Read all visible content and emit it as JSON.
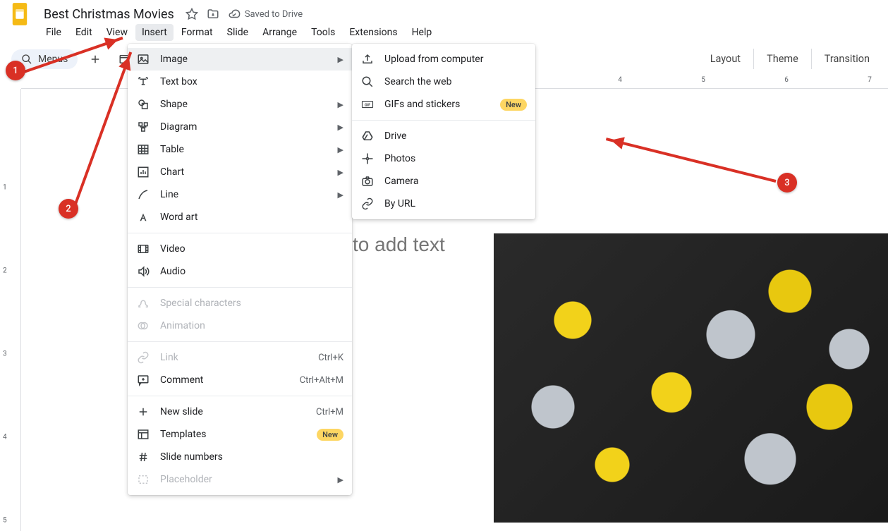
{
  "doc": {
    "title": "Best Christmas Movies",
    "save_status": "Saved to Drive"
  },
  "menus": {
    "file": "File",
    "edit": "Edit",
    "view": "View",
    "insert": "Insert",
    "format": "Format",
    "slide": "Slide",
    "arrange": "Arrange",
    "tools": "Tools",
    "extensions": "Extensions",
    "help": "Help"
  },
  "toolbar": {
    "search_label": "Menus",
    "layout": "Layout",
    "theme": "Theme",
    "transition": "Transition"
  },
  "ruler": {
    "h": {
      "4": "4",
      "5": "5",
      "6": "6",
      "7": "7"
    },
    "v": {
      "1": "1",
      "2": "2",
      "3": "3",
      "4": "4",
      "5": "5"
    }
  },
  "canvas": {
    "placeholder": "to add text"
  },
  "insert_menu": {
    "image": "Image",
    "text_box": "Text box",
    "shape": "Shape",
    "diagram": "Diagram",
    "table": "Table",
    "chart": "Chart",
    "line": "Line",
    "word_art": "Word art",
    "video": "Video",
    "audio": "Audio",
    "special_chars": "Special characters",
    "animation": "Animation",
    "link": "Link",
    "link_k": "Ctrl+K",
    "comment": "Comment",
    "comment_k": "Ctrl+Alt+M",
    "new_slide": "New slide",
    "new_slide_k": "Ctrl+M",
    "templates": "Templates",
    "slide_numbers": "Slide numbers",
    "placeholder": "Placeholder",
    "new_badge": "New"
  },
  "image_menu": {
    "upload": "Upload from computer",
    "search_web": "Search the web",
    "gifs": "GIFs and stickers",
    "new_badge": "New",
    "drive": "Drive",
    "photos": "Photos",
    "camera": "Camera",
    "by_url": "By URL"
  },
  "annotations": {
    "1": "1",
    "2": "2",
    "3": "3"
  }
}
